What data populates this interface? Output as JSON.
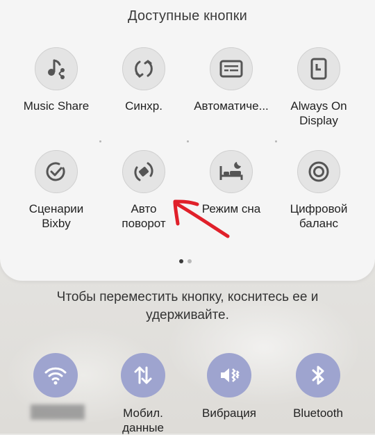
{
  "panel": {
    "title": "Доступные кнопки",
    "tiles": [
      {
        "label": "Music Share",
        "icon": "music-share-icon"
      },
      {
        "label": "Синхр.",
        "icon": "sync-icon"
      },
      {
        "label": "Автоматиче...",
        "icon": "subtitles-icon"
      },
      {
        "label": "Always On\nDisplay",
        "icon": "always-on-display-icon"
      },
      {
        "label": "Сценарии\nBixby",
        "icon": "bixby-routines-icon"
      },
      {
        "label": "Авто\nповорот",
        "icon": "auto-rotate-icon"
      },
      {
        "label": "Режим сна",
        "icon": "sleep-mode-icon"
      },
      {
        "label": "Цифровой\nбаланс",
        "icon": "digital-wellbeing-icon"
      }
    ],
    "page_indicator": {
      "current": 1,
      "total": 2
    }
  },
  "hint": "Чтобы переместить кнопку, коснитесь ее и удерживайте.",
  "quick_settings": [
    {
      "label": "",
      "icon": "wifi-icon"
    },
    {
      "label": "Мобил.\nданные",
      "icon": "mobile-data-icon"
    },
    {
      "label": "Вибрация",
      "icon": "vibrate-icon"
    },
    {
      "label": "Bluetooth",
      "icon": "bluetooth-icon"
    }
  ],
  "colors": {
    "tile_icon": "#5a5a5a",
    "quick_setting_active": "#9ea4cf",
    "annotation_arrow": "#e0202a"
  }
}
